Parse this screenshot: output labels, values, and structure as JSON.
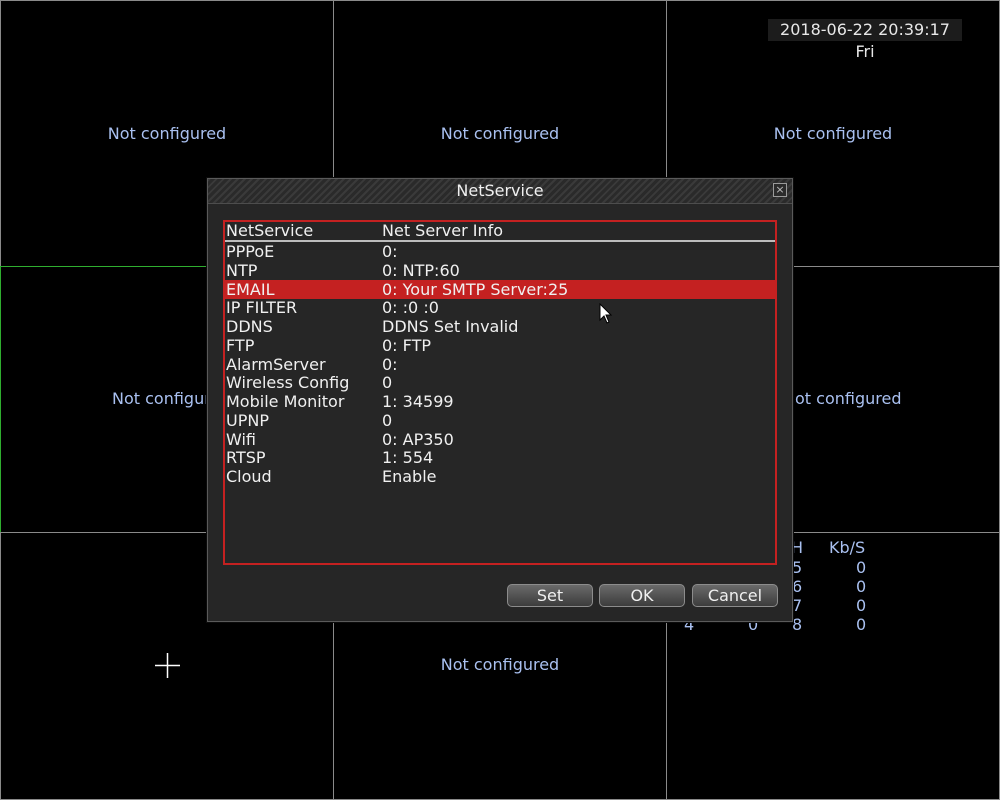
{
  "datetime": "2018-06-22 20:39:17 Fri",
  "channels": [
    {
      "label": "Not configured"
    },
    {
      "label": "Not configured"
    },
    {
      "label": "Not configured"
    },
    {
      "label": "Not configured"
    },
    {
      "label": "ot configured"
    },
    {
      "label": "Not configured"
    }
  ],
  "stats": {
    "headers": [
      "H",
      "Kb/S"
    ],
    "rows": [
      {
        "ch": "5",
        "kbs": "0"
      },
      {
        "ch": "6",
        "kbs": "0"
      },
      {
        "ch": "7",
        "kbs": "0"
      },
      {
        "ch": "8",
        "kbs": "0"
      }
    ],
    "partial_left": [
      "4",
      "0"
    ]
  },
  "dialog": {
    "title": "NetService",
    "close_icon": "×",
    "columns": [
      "NetService",
      "Net Server Info"
    ],
    "rows": [
      {
        "service": "PPPoE",
        "info": "0:"
      },
      {
        "service": "NTP",
        "info": "0: NTP:60"
      },
      {
        "service": "EMAIL",
        "info": "0: Your SMTP Server:25",
        "selected": true
      },
      {
        "service": "IP FILTER",
        "info": "0: :0 :0"
      },
      {
        "service": "DDNS",
        "info": "DDNS Set Invalid"
      },
      {
        "service": "FTP",
        "info": "0: FTP"
      },
      {
        "service": "AlarmServer",
        "info": "0:"
      },
      {
        "service": "Wireless Config",
        "info": "0"
      },
      {
        "service": "Mobile Monitor",
        "info": "1: 34599"
      },
      {
        "service": "UPNP",
        "info": "0"
      },
      {
        "service": "Wifi",
        "info": "0: AP350"
      },
      {
        "service": "RTSP",
        "info": "1: 554"
      },
      {
        "service": "Cloud",
        "info": "Enable"
      }
    ],
    "buttons": {
      "set": "Set",
      "ok": "OK",
      "cancel": "Cancel"
    }
  },
  "colors": {
    "accent": "#c42121",
    "grid_line": "#8a8a8a",
    "active_channel": "#2fae2f",
    "label": "#a9c0f0"
  }
}
